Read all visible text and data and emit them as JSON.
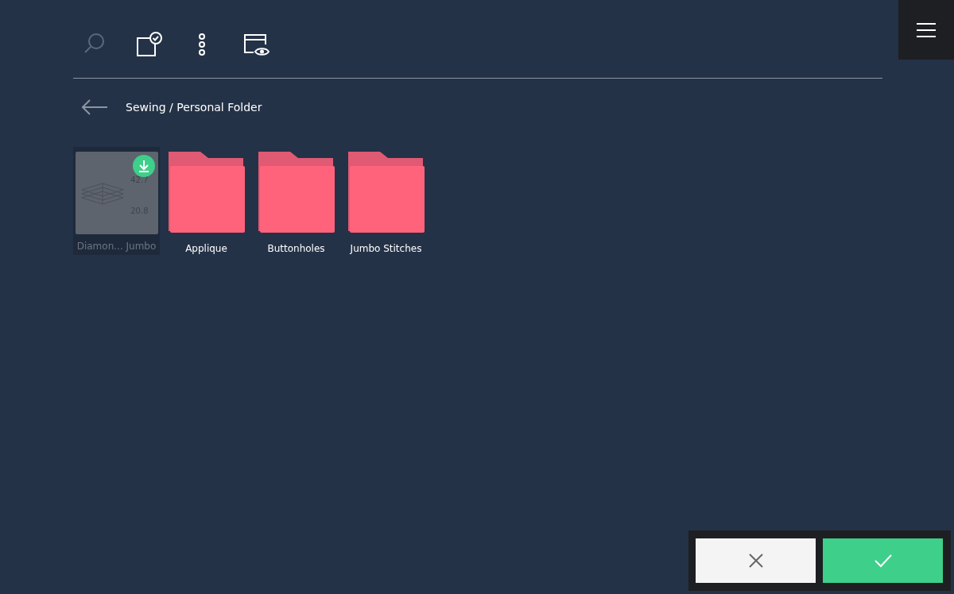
{
  "toolbar": [
    {
      "kind": "search",
      "disabled": true
    },
    {
      "kind": "select",
      "disabled": false
    },
    {
      "kind": "more",
      "disabled": false
    },
    {
      "kind": "preview",
      "disabled": false
    }
  ],
  "breadcrumb": "Sewing / Personal Folder",
  "items": [
    {
      "kind": "design",
      "label": "Diamon... Jumbo",
      "selected": true,
      "disabled": true,
      "download": true,
      "width_value": "42.7",
      "height_value": "20.8"
    },
    {
      "kind": "folder",
      "label": "Applique",
      "selected": false
    },
    {
      "kind": "folder",
      "label": "Buttonholes",
      "selected": false
    },
    {
      "kind": "folder",
      "label": "Jumbo Stitches",
      "selected": false
    }
  ]
}
